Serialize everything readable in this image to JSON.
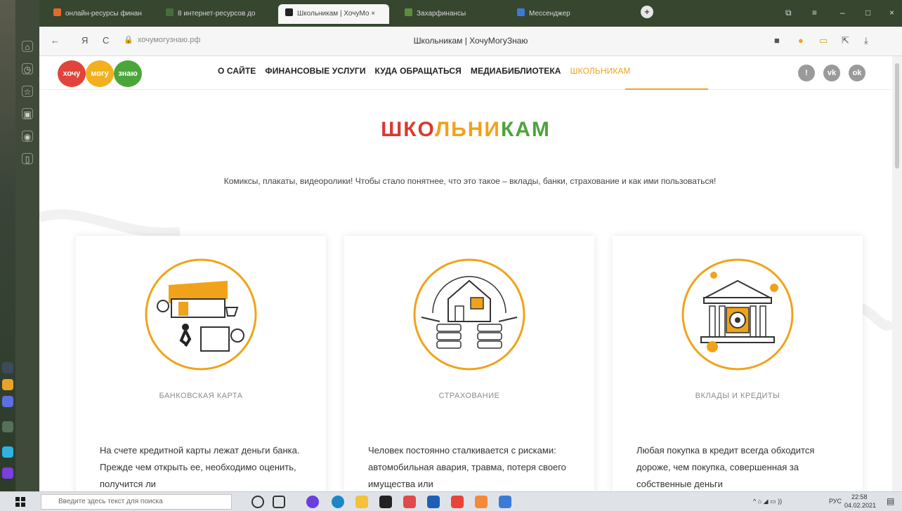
{
  "browser": {
    "tabs": [
      {
        "label": "онлайн-ресурсы финан",
        "active": false,
        "color": "#e36a2b"
      },
      {
        "label": "8 интернет-ресурсов до",
        "active": false,
        "color": "#4a6b3e"
      },
      {
        "label": "Школьникам | ХочуМо ×",
        "active": true,
        "color": "#222222"
      },
      {
        "label": "Захарфинансы",
        "active": false,
        "color": "#5d8f3a"
      },
      {
        "label": "Мессенджер",
        "active": false,
        "color": "#3b7bd8"
      }
    ],
    "new_tab": "+",
    "url": "хочумогузнаю.рф",
    "page_title": "Школьникам | ХочуМогуЗнаю",
    "nav": {
      "back": "←",
      "reload": "С",
      "yandex": "Я"
    }
  },
  "site": {
    "logo": [
      "хочу",
      "могу",
      "знаю"
    ],
    "logo_colors": [
      "#e1443a",
      "#f2b01e",
      "#4ba63a"
    ],
    "menu": [
      {
        "label": "О САЙТЕ",
        "active": false
      },
      {
        "label": "ФИНАНСОВЫЕ УСЛУГИ",
        "active": false
      },
      {
        "label": "КУДА ОБРАЩАТЬСЯ",
        "active": false
      },
      {
        "label": "МЕДИАБИБЛИОТЕКА",
        "active": false
      },
      {
        "label": "ШКОЛЬНИКАМ",
        "active": true
      }
    ],
    "header_icons": [
      "accessibility-icon",
      "vk-icon",
      "ok-icon"
    ],
    "hero": {
      "title_parts": [
        {
          "text": "ШКО",
          "color": "#d93a2f"
        },
        {
          "text": "ЛЬНИ",
          "color": "#f2a21b"
        },
        {
          "text": "КАМ",
          "color": "#4ea33a"
        }
      ],
      "subtitle": "Комиксы, плакаты, видеоролики! Чтобы стало понятнее, что это такое – вклады, банки, страхование и как ими пользоваться!"
    },
    "cards": [
      {
        "title": "БАНКОВСКАЯ КАРТА",
        "text": "На счете кредитной карты лежат деньги банка. Прежде чем открыть ее, необходимо оценить, получится ли"
      },
      {
        "title": "СТРАХОВАНИЕ",
        "text": "Человек постоянно сталкивается с рисками: автомобильная авария, травма, потеря своего имущества или"
      },
      {
        "title": "ВКЛАДЫ И КРЕДИТЫ",
        "text": "Любая покупка в кредит всегда обходится дороже, чем покупка, совершенная за собственные деньги"
      }
    ],
    "accent": "#f0a31a"
  },
  "taskbar": {
    "search_placeholder": "Введите здесь текст для поиска",
    "time": "22:58",
    "date": "04.02.2021",
    "lang": "РУС"
  }
}
